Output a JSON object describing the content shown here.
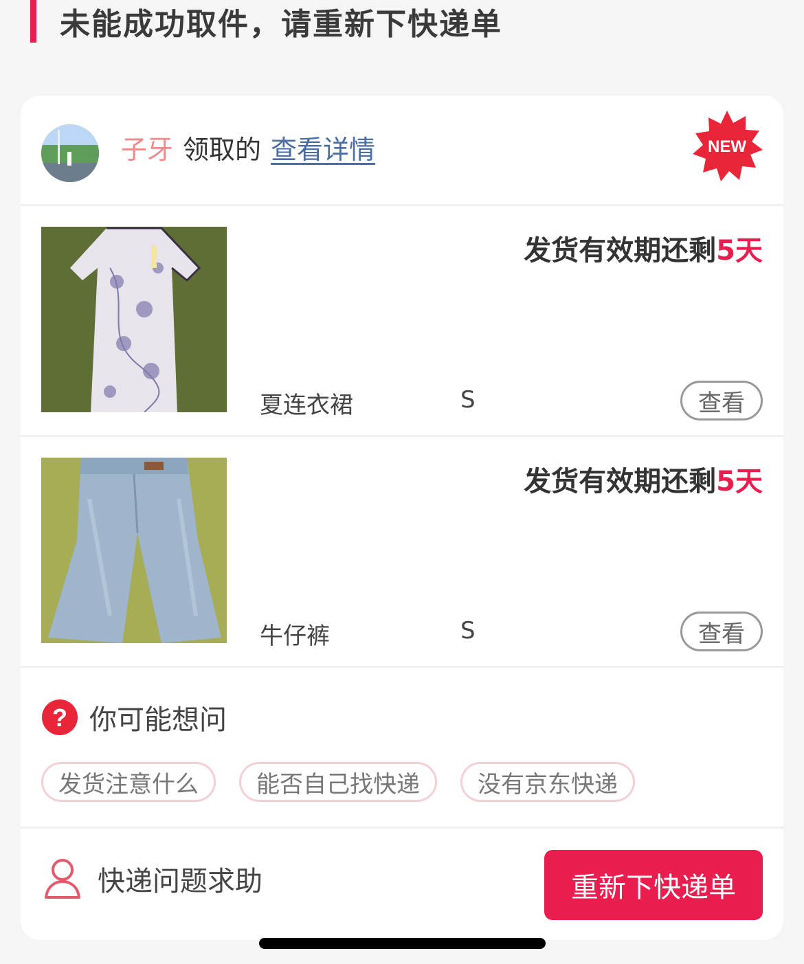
{
  "page": {
    "title": "未能成功取件，请重新下快递单"
  },
  "claim": {
    "name": "子牙",
    "action": "领取的",
    "link": "查看详情",
    "badge": "NEW"
  },
  "items": [
    {
      "image_icon": "dress-photo",
      "deadline_prefix": "发货有效期还剩",
      "deadline_value": "5天",
      "name": "夏连衣裙",
      "size": "S",
      "view_label": "查看"
    },
    {
      "image_icon": "jeans-photo",
      "deadline_prefix": "发货有效期还剩",
      "deadline_value": "5天",
      "name": "牛仔裤",
      "size": "S",
      "view_label": "查看"
    }
  ],
  "faq": {
    "title": "你可能想问",
    "chips": [
      "发货注意什么",
      "能否自己找快递",
      "没有京东快递"
    ]
  },
  "footer": {
    "help_label": "快递问题求助",
    "reorder_label": "重新下快递单"
  },
  "colors": {
    "accent": "#e91e4f",
    "link": "#4a6ea3",
    "name_pink": "#f08a8a",
    "chip_border": "#f3cfd6"
  }
}
